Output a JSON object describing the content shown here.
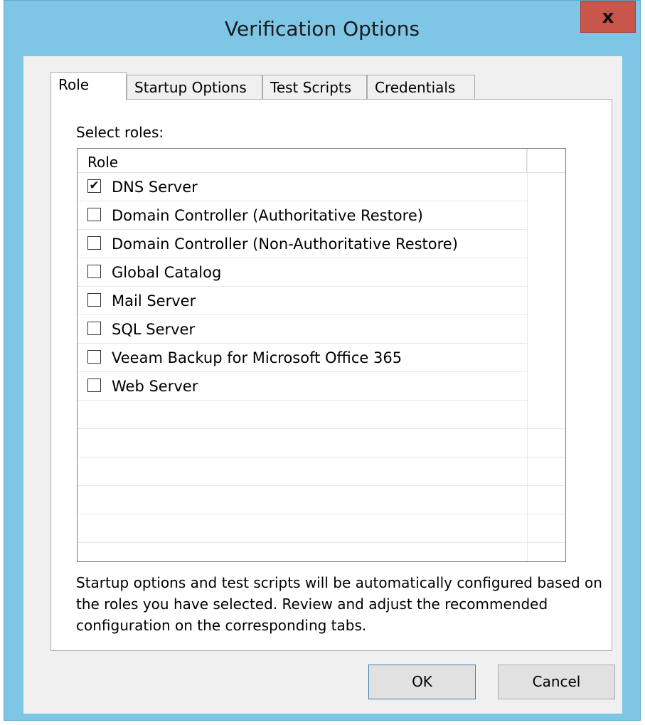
{
  "window": {
    "title": "Verification Options",
    "close_label": "x"
  },
  "tabs": [
    {
      "label": "Role",
      "active": true
    },
    {
      "label": "Startup Options",
      "active": false
    },
    {
      "label": "Test Scripts",
      "active": false
    },
    {
      "label": "Credentials",
      "active": false
    }
  ],
  "roles_panel": {
    "select_label": "Select roles:",
    "column_header": "Role",
    "roles": [
      {
        "label": "DNS Server",
        "checked": true,
        "check_glyph": "✔"
      },
      {
        "label": "Domain Controller (Authoritative Restore)",
        "checked": false,
        "check_glyph": ""
      },
      {
        "label": "Domain Controller (Non-Authoritative Restore)",
        "checked": false,
        "check_glyph": ""
      },
      {
        "label": "Global Catalog",
        "checked": false,
        "check_glyph": ""
      },
      {
        "label": "Mail Server",
        "checked": false,
        "check_glyph": ""
      },
      {
        "label": "SQL Server",
        "checked": false,
        "check_glyph": ""
      },
      {
        "label": "Veeam Backup for Microsoft Office 365",
        "checked": false,
        "check_glyph": ""
      },
      {
        "label": "Web Server",
        "checked": false,
        "check_glyph": ""
      }
    ],
    "info_text": "Startup options and test scripts will be automatically configured based on the roles you have selected. Review and adjust the recommended configuration on the corresponding tabs."
  },
  "buttons": {
    "ok_label": "OK",
    "cancel_label": "Cancel"
  },
  "colors": {
    "title_bar": "#7fc6e6",
    "close_button": "#c9564a",
    "ok_border": "#3c7fb1"
  }
}
